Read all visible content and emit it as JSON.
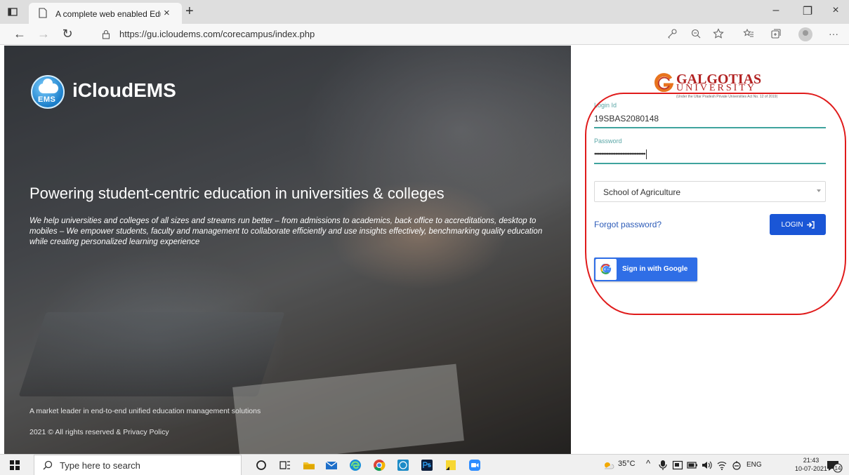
{
  "browser": {
    "tab_title": "A complete web enabled Educati",
    "tab_close": "×",
    "new_tab": "+",
    "url": "https://gu.icloudems.com/corecampus/index.php",
    "win_minimize": "–",
    "win_restore": "❐",
    "win_close": "×",
    "back": "←",
    "forward": "→",
    "refresh": "↻",
    "more": "···"
  },
  "hero": {
    "brand_name": "iCloudEMS",
    "brand_logo_text": "EMS",
    "headline": "Powering student-centric education in universities & colleges",
    "description": "We help universities and colleges of all sizes and streams run better – from admissions to academics, back office to accreditations, desktop to mobiles – We empower students, faculty and management to collaborate efficiently and use insights effectively, benchmarking quality education while creating personalized learning experience",
    "footer_tagline": "A market leader in end-to-end unified education management solutions",
    "footer_copyright": "2021 © All rights reserved & Privacy Policy"
  },
  "login": {
    "university_name": "GALGOTIAS",
    "university_sub": "UNIVERSITY",
    "university_note": "(Under the Uttar Pradesh Private Universities Act No. 12 of 2019)",
    "login_id_label": "Login Id",
    "login_id_value": "19SBAS2080148",
    "password_label": "Password",
    "password_value": "•••••••••••••••••••••••••••••",
    "school_select_value": "School of Agriculture",
    "forgot_password": "Forgot password?",
    "login_button": "LOGIN",
    "google_button": "Sign in with Google",
    "accent_color": "#3ea39d",
    "button_color": "#1a56d6",
    "annotation_color": "#e01b1b"
  },
  "taskbar": {
    "search_placeholder": "Type here to search",
    "weather": "35°C",
    "language": "ENG",
    "time": "21:43",
    "date": "10-07-2021",
    "notifications_count": "14"
  }
}
